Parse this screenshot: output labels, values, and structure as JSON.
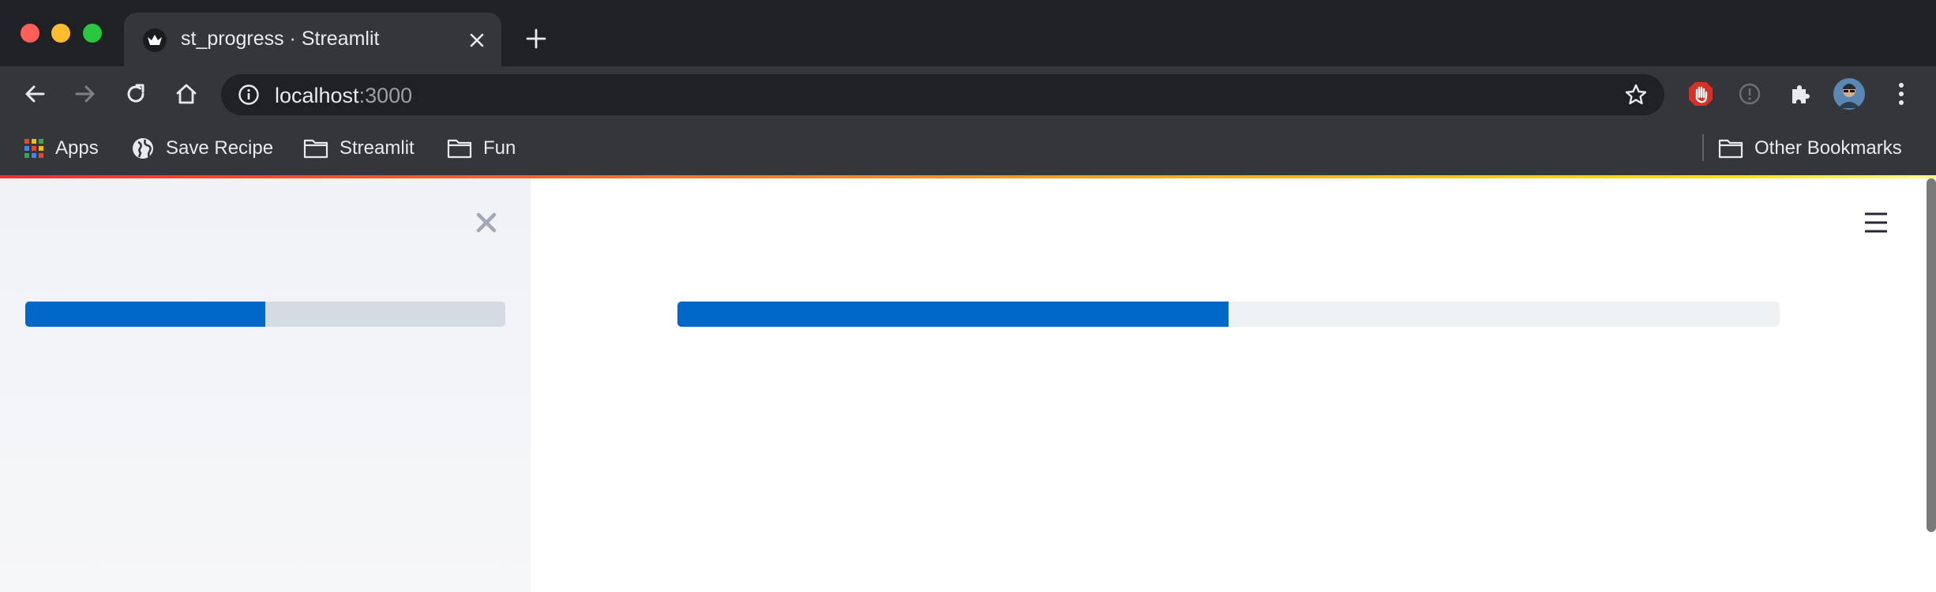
{
  "browser": {
    "tab": {
      "title": "st_progress · Streamlit"
    },
    "address": {
      "host": "localhost",
      "port": ":3000"
    },
    "bookmarks": [
      {
        "label": "Apps",
        "icon": "apps-grid-icon"
      },
      {
        "label": "Save Recipe",
        "icon": "globe-icon"
      },
      {
        "label": "Streamlit",
        "icon": "folder-icon"
      },
      {
        "label": "Fun",
        "icon": "folder-icon"
      }
    ],
    "other_bookmarks": {
      "label": "Other Bookmarks",
      "icon": "folder-icon"
    }
  },
  "app": {
    "sidebar": {
      "progress": 0.5
    },
    "main": {
      "progress": 0.5
    }
  },
  "colors": {
    "progress_fill": "#0068c9",
    "decoration_start": "#ff2b2b",
    "decoration_end": "#ffe312",
    "sidebar_bg": "#f0f2f6"
  }
}
